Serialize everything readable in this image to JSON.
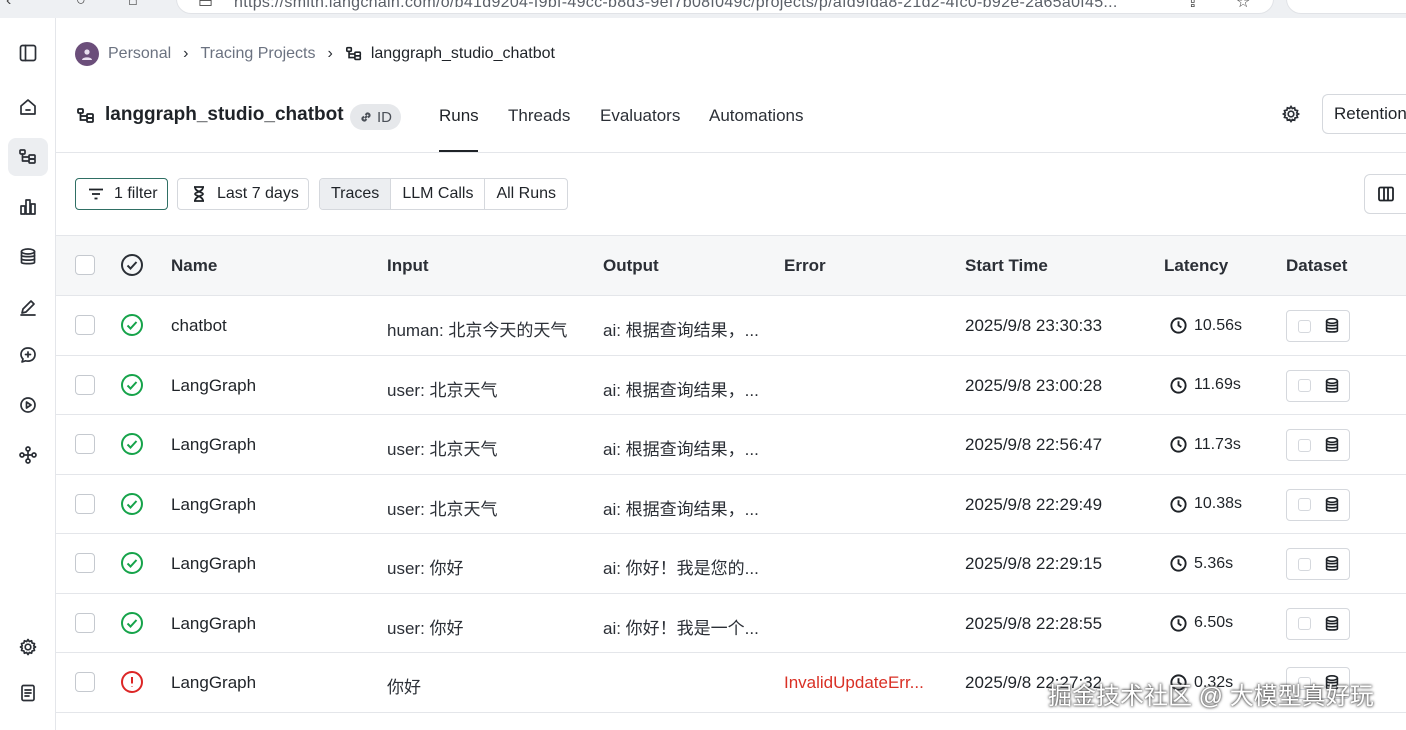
{
  "browser": {
    "url": "https://smith.langchain.com/o/b41d9204-f9bf-49cc-b8d3-9ef7b08f049c/projects/p/afd9fda8-21d2-4fc0-b92e-2a65a0f45..."
  },
  "breadcrumb": {
    "org": "Personal",
    "section": "Tracing Projects",
    "project": "langgraph_studio_chatbot"
  },
  "header": {
    "title": "langgraph_studio_chatbot",
    "id_label": "ID",
    "tabs": [
      {
        "label": "Runs",
        "active": true
      },
      {
        "label": "Threads",
        "active": false
      },
      {
        "label": "Evaluators",
        "active": false
      },
      {
        "label": "Automations",
        "active": false
      }
    ],
    "retention_label": "Retention"
  },
  "toolbar": {
    "filter_label": "1 filter",
    "date_range_label": "Last 7 days",
    "run_type_options": [
      "Traces",
      "LLM Calls",
      "All Runs"
    ],
    "run_type_selected": "Traces"
  },
  "table": {
    "columns": [
      "Name",
      "Input",
      "Output",
      "Error",
      "Start Time",
      "Latency",
      "Dataset"
    ],
    "rows": [
      {
        "status": "success",
        "name": "chatbot",
        "input": "human: 北京今天的天气",
        "output": "ai: 根据查询结果，...",
        "error": "",
        "start_time": "2025/9/8 23:30:33",
        "latency": "10.56s"
      },
      {
        "status": "success",
        "name": "LangGraph",
        "input": "user: 北京天气",
        "output": "ai: 根据查询结果，...",
        "error": "",
        "start_time": "2025/9/8 23:00:28",
        "latency": "11.69s"
      },
      {
        "status": "success",
        "name": "LangGraph",
        "input": "user: 北京天气",
        "output": "ai: 根据查询结果，...",
        "error": "",
        "start_time": "2025/9/8 22:56:47",
        "latency": "11.73s"
      },
      {
        "status": "success",
        "name": "LangGraph",
        "input": "user: 北京天气",
        "output": "ai: 根据查询结果，...",
        "error": "",
        "start_time": "2025/9/8 22:29:49",
        "latency": "10.38s"
      },
      {
        "status": "success",
        "name": "LangGraph",
        "input": "user: 你好",
        "output": "ai: 你好！我是您的...",
        "error": "",
        "start_time": "2025/9/8 22:29:15",
        "latency": "5.36s"
      },
      {
        "status": "success",
        "name": "LangGraph",
        "input": "user: 你好",
        "output": "ai: 你好！我是一个...",
        "error": "",
        "start_time": "2025/9/8 22:28:55",
        "latency": "6.50s"
      },
      {
        "status": "error",
        "name": "LangGraph",
        "input": "你好",
        "output": "",
        "error": "InvalidUpdateErr...",
        "start_time": "2025/9/8 22:27:32",
        "latency": "0.32s"
      }
    ]
  },
  "watermark": "掘金技术社区 @ 大模型真好玩",
  "colors": {
    "success": "#16a34a",
    "error": "#dc2626",
    "accent_border": "#2f6f64"
  },
  "icons": [
    "sidebar-toggle-icon",
    "home-icon",
    "tracing-projects-icon",
    "dashboards-icon",
    "datasets-icon",
    "annotation-icon",
    "prompts-icon",
    "deployments-icon",
    "studio-icon",
    "settings-icon",
    "docs-icon"
  ]
}
